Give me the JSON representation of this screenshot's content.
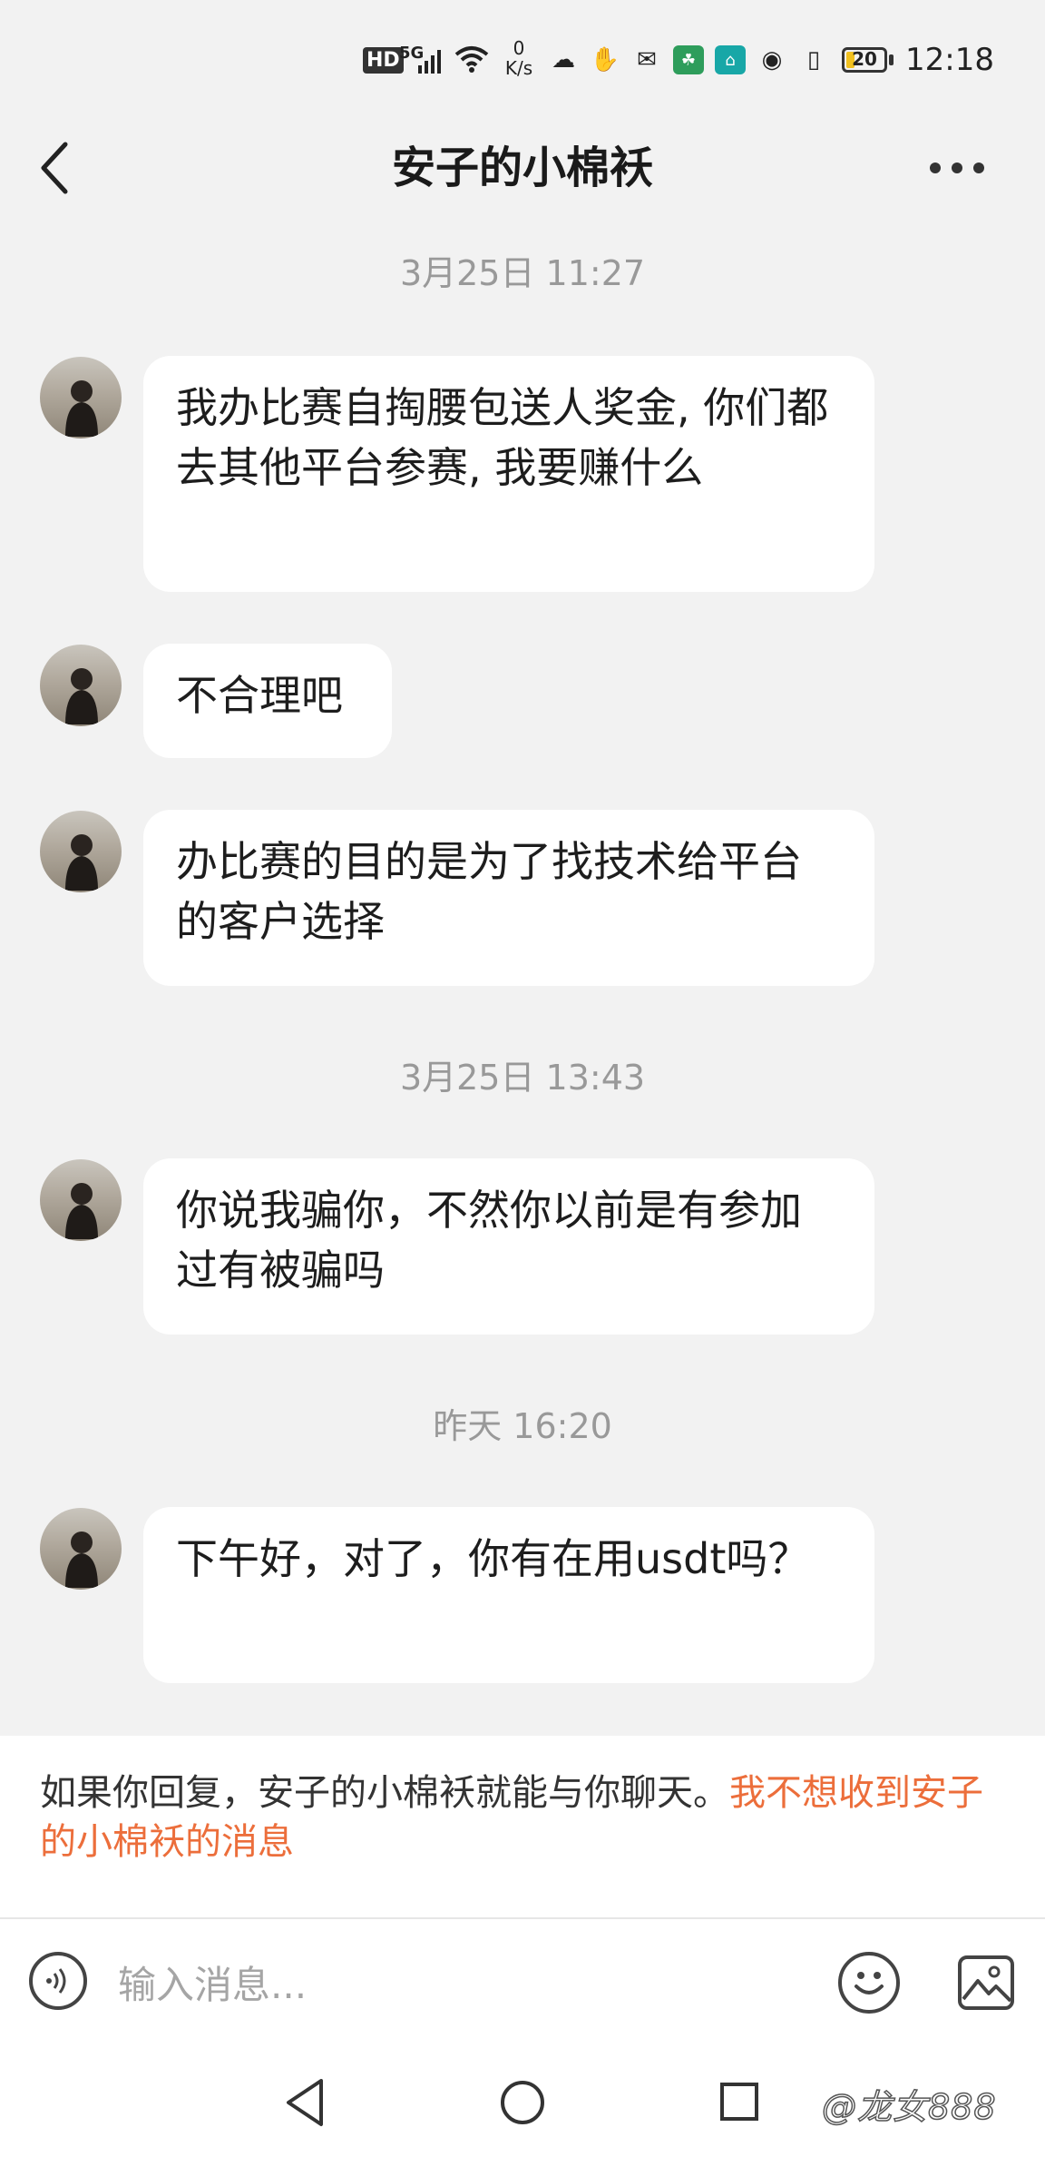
{
  "status_bar": {
    "hd": "HD",
    "network": "5G",
    "speed_value": "0",
    "speed_unit": "K/s",
    "battery": "20",
    "time": "12:18"
  },
  "header": {
    "title": "安子的小棉袄"
  },
  "messages": [
    {
      "type": "timestamp",
      "text": "3月25日 11:27"
    },
    {
      "type": "incoming",
      "text": "我办比赛自掏腰包送人奖金, 你们都去其他平台参赛, 我要赚什么"
    },
    {
      "type": "incoming",
      "text": "不合理吧"
    },
    {
      "type": "incoming",
      "text": "办比赛的目的是为了找技术给平台的客户选择"
    },
    {
      "type": "timestamp",
      "text": "3月25日 13:43"
    },
    {
      "type": "incoming",
      "text": "你说我骗你，不然你以前是有参加过有被骗吗"
    },
    {
      "type": "timestamp",
      "text": "昨天 16:20"
    },
    {
      "type": "incoming",
      "text": "下午好，对了，你有在用usdt吗？"
    }
  ],
  "notice": {
    "text": "如果你回复，安子的小棉袄就能与你聊天。",
    "link": "我不想收到安子的小棉袄的消息"
  },
  "input_bar": {
    "placeholder": "输入消息..."
  },
  "watermark": "@龙女888",
  "colors": {
    "background": "#f2f2f2",
    "bubble": "#ffffff",
    "accent_link": "#ec6e3b",
    "timestamp": "#999999"
  }
}
